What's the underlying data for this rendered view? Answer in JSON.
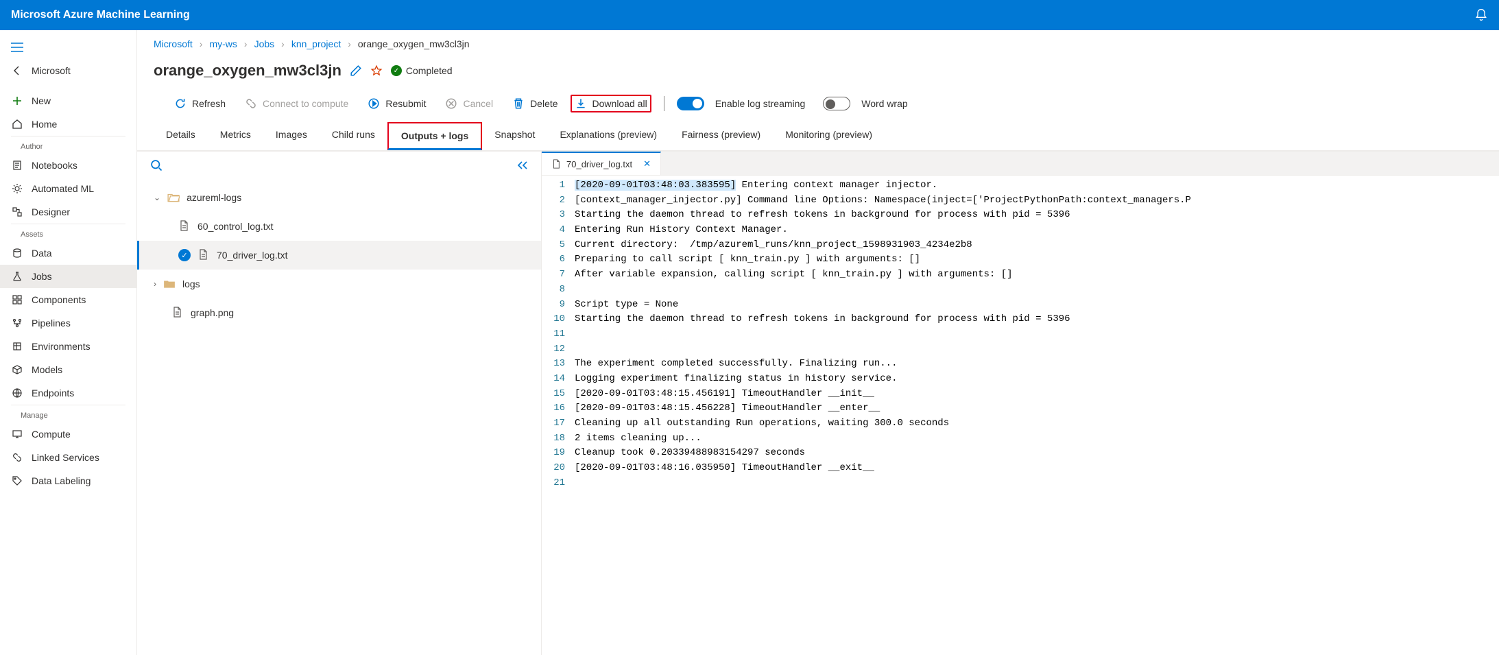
{
  "app_title": "Microsoft Azure Machine Learning",
  "breadcrumb": [
    "Microsoft",
    "my-ws",
    "Jobs",
    "knn_project",
    "orange_oxygen_mw3cl3jn"
  ],
  "header": {
    "job_name": "orange_oxygen_mw3cl3jn",
    "status": "Completed"
  },
  "toolbar": {
    "refresh": "Refresh",
    "connect": "Connect to compute",
    "resubmit": "Resubmit",
    "cancel": "Cancel",
    "delete": "Delete",
    "download": "Download all",
    "log_streaming": "Enable log streaming",
    "word_wrap": "Word wrap"
  },
  "sidebar": {
    "back": "Microsoft",
    "new": "New",
    "home": "Home",
    "sections": {
      "author": "Author",
      "assets": "Assets",
      "manage": "Manage"
    },
    "author_items": [
      "Notebooks",
      "Automated ML",
      "Designer"
    ],
    "assets_items": [
      "Data",
      "Jobs",
      "Components",
      "Pipelines",
      "Environments",
      "Models",
      "Endpoints"
    ],
    "manage_items": [
      "Compute",
      "Linked Services",
      "Data Labeling"
    ]
  },
  "tabs": [
    "Details",
    "Metrics",
    "Images",
    "Child runs",
    "Outputs + logs",
    "Snapshot",
    "Explanations (preview)",
    "Fairness (preview)",
    "Monitoring (preview)"
  ],
  "active_tab": "Outputs + logs",
  "tree": {
    "folders": [
      {
        "name": "azureml-logs",
        "open": true,
        "children": [
          {
            "name": "60_control_log.txt",
            "selected": false
          },
          {
            "name": "70_driver_log.txt",
            "selected": true
          }
        ]
      },
      {
        "name": "logs",
        "open": false,
        "children": []
      }
    ],
    "files": [
      {
        "name": "graph.png"
      }
    ]
  },
  "open_file": "70_driver_log.txt",
  "log_lines": [
    "[2020-09-01T03:48:03.383595] Entering context manager injector.",
    "[context_manager_injector.py] Command line Options: Namespace(inject=['ProjectPythonPath:context_managers.P",
    "Starting the daemon thread to refresh tokens in background for process with pid = 5396",
    "Entering Run History Context Manager.",
    "Current directory:  /tmp/azureml_runs/knn_project_1598931903_4234e2b8",
    "Preparing to call script [ knn_train.py ] with arguments: []",
    "After variable expansion, calling script [ knn_train.py ] with arguments: []",
    "",
    "Script type = None",
    "Starting the daemon thread to refresh tokens in background for process with pid = 5396",
    "",
    "",
    "The experiment completed successfully. Finalizing run...",
    "Logging experiment finalizing status in history service.",
    "[2020-09-01T03:48:15.456191] TimeoutHandler __init__",
    "[2020-09-01T03:48:15.456228] TimeoutHandler __enter__",
    "Cleaning up all outstanding Run operations, waiting 300.0 seconds",
    "2 items cleaning up...",
    "Cleanup took 0.20339488983154297 seconds",
    "[2020-09-01T03:48:16.035950] TimeoutHandler __exit__",
    ""
  ]
}
